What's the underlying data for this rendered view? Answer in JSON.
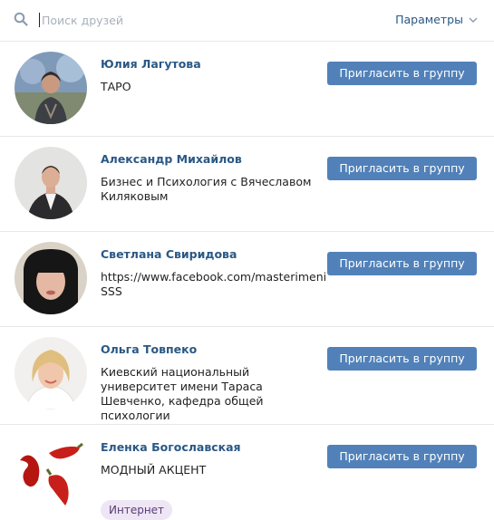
{
  "search": {
    "placeholder": "Поиск друзей",
    "value": ""
  },
  "header": {
    "params_label": "Параметры"
  },
  "icons": {
    "search": "search-icon",
    "params": "chevron-down-icon"
  },
  "colors": {
    "link": "#2a5885",
    "button": "#5181b8",
    "tag_bg": "#eee6f4"
  },
  "invite_label": "Пригласить в группу",
  "friends": [
    {
      "name": "Юлия Лагутова",
      "desc": "ТАРО"
    },
    {
      "name": "Александр Михайлов",
      "desc": "Бизнес и Психология с Вячеславом Киляковым"
    },
    {
      "name": "Светлана Свиридова",
      "desc": "https://www.facebook.com/masterimeni SSS"
    },
    {
      "name": "Ольга Товпеко",
      "desc": "Киевский национальный университет имени Тараса Шевченко, кафедра общей психологии"
    },
    {
      "name": "Еленка Богославская",
      "desc": "МОДНЫЙ АКЦЕНТ",
      "tag": "Интернет"
    }
  ]
}
